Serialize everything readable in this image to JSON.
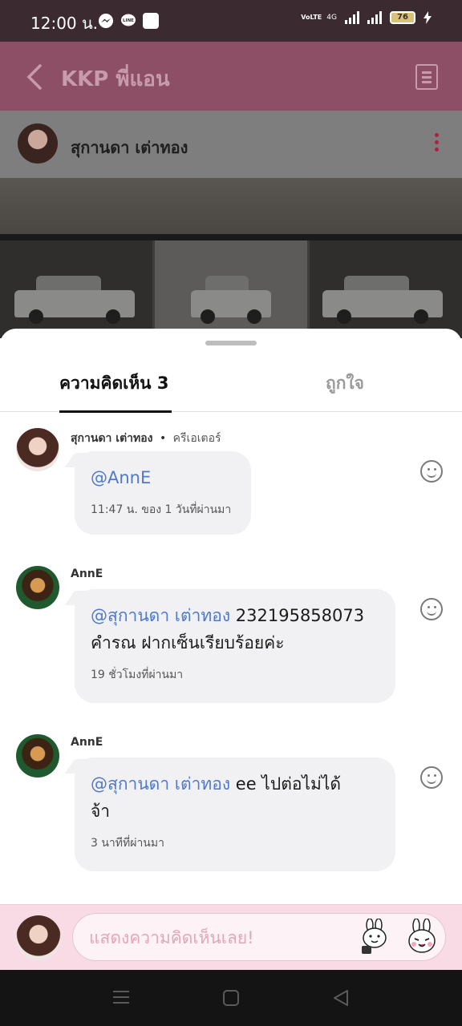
{
  "status_bar": {
    "time": "12:00 น.",
    "app_icons": [
      "messenger-icon",
      "line-icon",
      "square-icon"
    ],
    "network_label": "VoLTE",
    "network_type": "4G",
    "battery": "76"
  },
  "app_bar": {
    "title": "KKP พี่แอน",
    "back_icon": "chevron-left-icon",
    "menu_icon": "document-icon"
  },
  "post": {
    "author": "สุกานดา เต่าทอง",
    "more_icon": "more-vertical-icon"
  },
  "sheet": {
    "tabs": [
      {
        "label": "ความคิดเห็น 3",
        "active": true
      },
      {
        "label": "ถูกใจ",
        "active": false
      }
    ]
  },
  "comments": [
    {
      "author": "สุกานดา เต่าทอง",
      "separator": "•",
      "role": "ครีเอเตอร์",
      "mention": "@AnnE",
      "text": "",
      "time": "11:47 น. ของ 1 วันที่ผ่านมา"
    },
    {
      "author": "AnnE",
      "mention": "@สุกานดา เต่าทอง",
      "text_line1": " 232195858073",
      "text_line2": "คำรณ ฝากเซ็นเรียบร้อยค่ะ",
      "time": "19 ชั่วโมงที่ผ่านมา"
    },
    {
      "author": "AnnE",
      "mention": "@สุกานดา เต่าทอง",
      "text_line1": " ee ไปต่อไม่ได้",
      "text_line2": "จ้า",
      "time": "3 นาทีที่ผ่านมา"
    }
  ],
  "input": {
    "placeholder": "แสดงความคิดเห็นเลย!",
    "sticker_icons": [
      "brown-cony-sticker-icon",
      "cony-sticker-icon"
    ]
  },
  "colors": {
    "mention": "#4f79c9",
    "input_bar_bg": "#f9dbe6",
    "placeholder": "#e3a5ba"
  }
}
